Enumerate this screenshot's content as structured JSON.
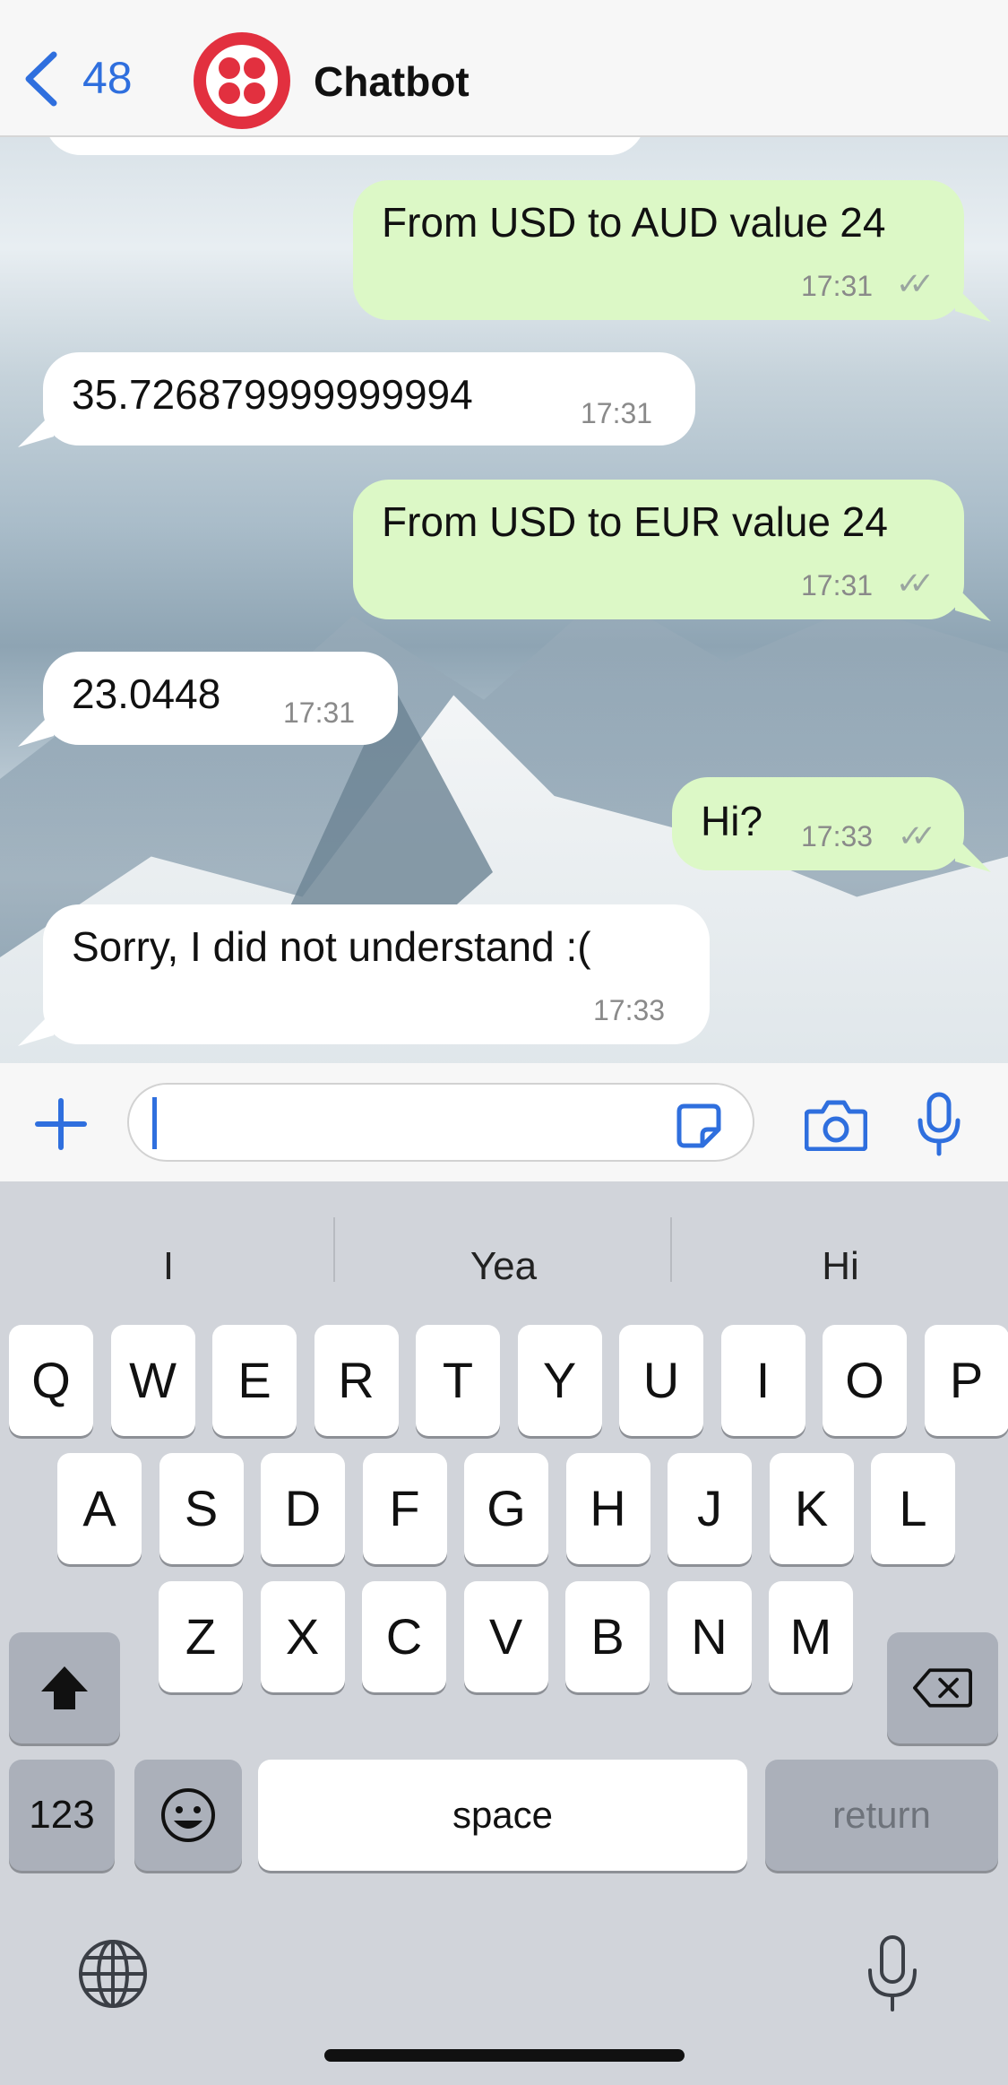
{
  "header": {
    "back_count": "48",
    "title": "Chatbot",
    "accent": "#2f6fde",
    "avatar_color": "#e2303f"
  },
  "messages": [
    {
      "dir": "out",
      "text": "From USD to AUD value 24",
      "time": "17:31",
      "status": "read"
    },
    {
      "dir": "in",
      "text": "35.726879999999994",
      "time": "17:31"
    },
    {
      "dir": "out",
      "text": "From USD to EUR value 24",
      "time": "17:31",
      "status": "read"
    },
    {
      "dir": "in",
      "text": "23.0448",
      "time": "17:31"
    },
    {
      "dir": "out",
      "text": "Hi?",
      "time": "17:33",
      "status": "read"
    },
    {
      "dir": "in",
      "text": "Sorry, I did not understand :(",
      "time": "17:33"
    }
  ],
  "input": {
    "value": ""
  },
  "suggestions": [
    "I",
    "Yea",
    "Hi"
  ],
  "keyboard": {
    "row1": [
      "Q",
      "W",
      "E",
      "R",
      "T",
      "Y",
      "U",
      "I",
      "O",
      "P"
    ],
    "row2": [
      "A",
      "S",
      "D",
      "F",
      "G",
      "H",
      "J",
      "K",
      "L"
    ],
    "row3": [
      "Z",
      "X",
      "C",
      "V",
      "B",
      "N",
      "M"
    ],
    "numbers": "123",
    "space": "space",
    "return": "return"
  },
  "icons": {
    "back": "chevron-left-icon",
    "plus": "plus-icon",
    "sticker": "sticker-icon",
    "camera": "camera-icon",
    "mic": "microphone-icon",
    "shift": "shift-icon",
    "delete": "backspace-icon",
    "emoji": "emoji-icon",
    "globe": "globe-icon",
    "dictation": "dictation-icon"
  }
}
